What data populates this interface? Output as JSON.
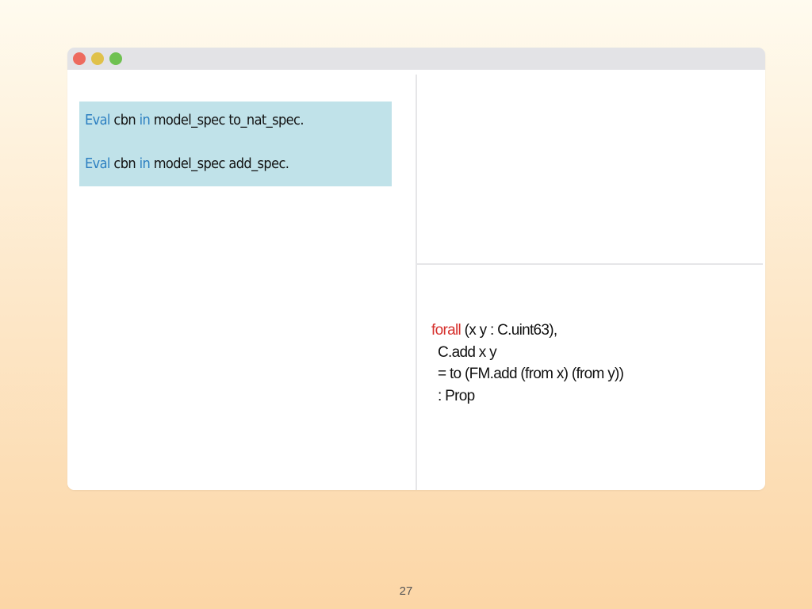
{
  "editor": {
    "lines": [
      {
        "keyword": "Eval",
        "text1": "cbn",
        "keyword2": "in",
        "text2": "model_spec to_nat_spec."
      },
      {
        "keyword": "Eval",
        "text1": "cbn",
        "keyword2": "in",
        "text2": "model_spec add_spec."
      }
    ]
  },
  "goal": {
    "line1_keyword": "forall",
    "line1_rest": "(x y : C.uint63),",
    "line2": "C.add x y",
    "line3": "= to (FM.add (from x) (from y))",
    "line4": ": Prop"
  },
  "slide": {
    "page_number": "27"
  },
  "colors": {
    "keyword_blue": "#2c7fc1",
    "keyword_red": "#d6302c",
    "highlight": "#c0e2e9",
    "close": "#ed6a5e",
    "minimize": "#e0c14a",
    "maximize": "#6fc151"
  },
  "icons": {
    "close": "red-circle",
    "minimize": "yellow-circle",
    "maximize": "green-circle"
  }
}
